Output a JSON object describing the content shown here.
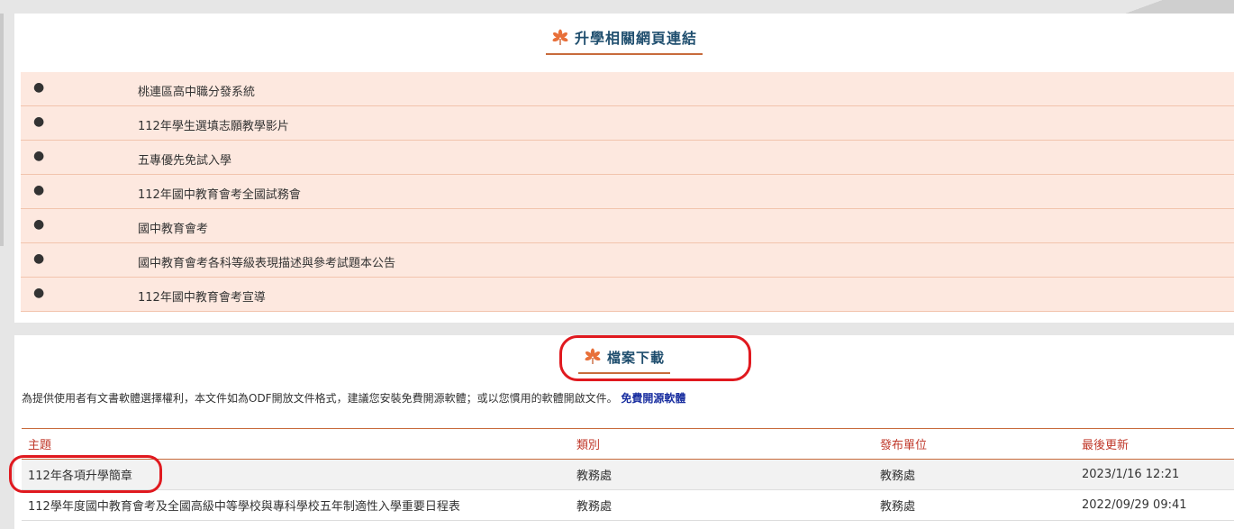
{
  "links_section": {
    "title": "升學相關網頁連結",
    "items": [
      {
        "label": "桃連區高中職分發系統"
      },
      {
        "label": "112年學生選填志願教學影片"
      },
      {
        "label": "五專優先免試入學"
      },
      {
        "label": "112年國中教育會考全國試務會"
      },
      {
        "label": "國中教育會考"
      },
      {
        "label": "國中教育會考各科等級表現描述與參考試題本公告"
      },
      {
        "label": "112年國中教育會考宣導"
      }
    ]
  },
  "files_section": {
    "title": "檔案下載",
    "notice_text": "為提供使用者有文書軟體選擇權利，本文件如為ODF開放文件格式，建議您安裝免費開源軟體；或以您慣用的軟體開啟文件。",
    "notice_link": "免費開源軟體",
    "columns": [
      "主題",
      "類別",
      "發布單位",
      "最後更新"
    ],
    "rows": [
      {
        "subject": "112年各項升學簡章",
        "category": "教務處",
        "unit": "教務處",
        "updated": "2023/1/16 12:21"
      },
      {
        "subject": "112學年度國中教育會考及全國高級中等學校與專科學校五年制適性入學重要日程表",
        "category": "教務處",
        "unit": "教務處",
        "updated": "2022/09/29 09:41"
      }
    ]
  },
  "colors": {
    "accent": "#c86b3c",
    "link_row_bg": "#fde8df",
    "title_text": "#1f4e6e",
    "header_text": "#c0392b",
    "annotation_red": "#e0191f"
  }
}
